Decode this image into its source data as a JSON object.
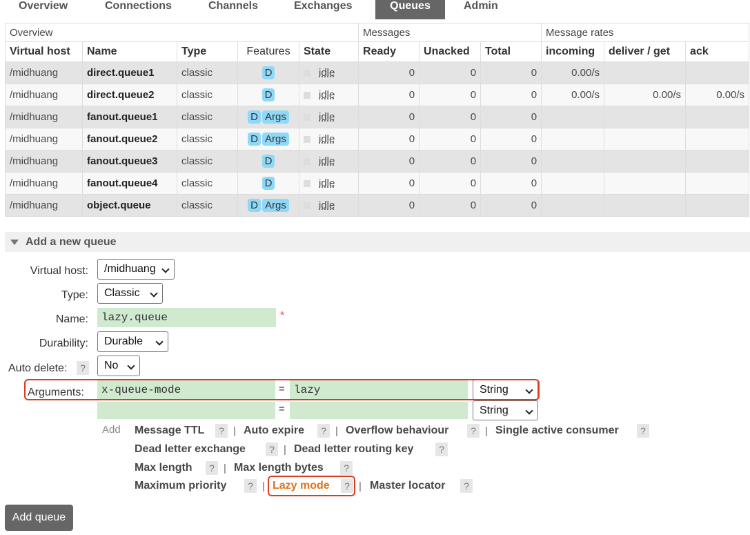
{
  "tabs": [
    "Overview",
    "Connections",
    "Channels",
    "Exchanges",
    "Queues",
    "Admin"
  ],
  "active_tab": "Queues",
  "table": {
    "groups": [
      "Overview",
      "Messages",
      "Message rates"
    ],
    "columns": [
      "Virtual host",
      "Name",
      "Type",
      "Features",
      "State",
      "Ready",
      "Unacked",
      "Total",
      "incoming",
      "deliver / get",
      "ack"
    ],
    "rows": [
      {
        "vhost": "/midhuang",
        "name": "direct.queue1",
        "type": "classic",
        "features": [
          "D"
        ],
        "state": "idle",
        "ready": "0",
        "unacked": "0",
        "total": "0",
        "incoming": "0.00/s",
        "deliver": "",
        "ack": ""
      },
      {
        "vhost": "/midhuang",
        "name": "direct.queue2",
        "type": "classic",
        "features": [
          "D"
        ],
        "state": "idle",
        "ready": "0",
        "unacked": "0",
        "total": "0",
        "incoming": "0.00/s",
        "deliver": "0.00/s",
        "ack": "0.00/s"
      },
      {
        "vhost": "/midhuang",
        "name": "fanout.queue1",
        "type": "classic",
        "features": [
          "D",
          "Args"
        ],
        "state": "idle",
        "ready": "0",
        "unacked": "0",
        "total": "0",
        "incoming": "",
        "deliver": "",
        "ack": ""
      },
      {
        "vhost": "/midhuang",
        "name": "fanout.queue2",
        "type": "classic",
        "features": [
          "D",
          "Args"
        ],
        "state": "idle",
        "ready": "0",
        "unacked": "0",
        "total": "0",
        "incoming": "",
        "deliver": "",
        "ack": ""
      },
      {
        "vhost": "/midhuang",
        "name": "fanout.queue3",
        "type": "classic",
        "features": [
          "D"
        ],
        "state": "idle",
        "ready": "0",
        "unacked": "0",
        "total": "0",
        "incoming": "",
        "deliver": "",
        "ack": ""
      },
      {
        "vhost": "/midhuang",
        "name": "fanout.queue4",
        "type": "classic",
        "features": [
          "D"
        ],
        "state": "idle",
        "ready": "0",
        "unacked": "0",
        "total": "0",
        "incoming": "",
        "deliver": "",
        "ack": ""
      },
      {
        "vhost": "/midhuang",
        "name": "object.queue",
        "type": "classic",
        "features": [
          "D",
          "Args"
        ],
        "state": "idle",
        "ready": "0",
        "unacked": "0",
        "total": "0",
        "incoming": "",
        "deliver": "",
        "ack": ""
      }
    ]
  },
  "form": {
    "section_title": "Add a new queue",
    "vhost_label": "Virtual host:",
    "vhost_value": "/midhuang",
    "type_label": "Type:",
    "type_value": "Classic",
    "name_label": "Name:",
    "name_value": "lazy.queue",
    "required_mark": "*",
    "durability_label": "Durability:",
    "durability_value": "Durable",
    "auto_delete_label": "Auto delete:",
    "auto_delete_value": "No",
    "help_mark": "?",
    "arguments_label": "Arguments:",
    "arg1_key": "x-queue-mode",
    "arg1_value": "lazy",
    "arg1_type": "String",
    "arg2_key": "",
    "arg2_value": "",
    "arg2_type": "String",
    "equals": "=",
    "add_label": "Add",
    "options_row1": [
      "Message TTL",
      "Auto expire",
      "Overflow behaviour",
      "Single active consumer"
    ],
    "options_row2": [
      "Dead letter exchange",
      "Dead letter routing key"
    ],
    "options_row3": [
      "Max length",
      "Max length bytes"
    ],
    "options_row4": [
      "Maximum priority",
      "Lazy mode",
      "Master locator"
    ],
    "highlight_color": "#e03a1e",
    "lazy_mode_color": "#e0721e",
    "submit_label": "Add queue"
  }
}
